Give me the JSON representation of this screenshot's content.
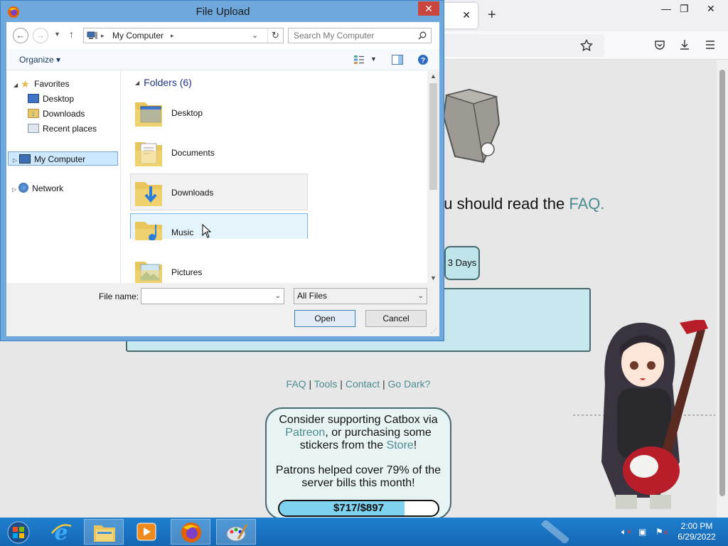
{
  "browser": {
    "tab_close": "✕",
    "new_tab": "+",
    "window_controls": {
      "minimize": "—",
      "restore": "❐",
      "close": "✕"
    },
    "nav_icons": [
      "star-icon",
      "pocket-icon",
      "download-icon",
      "menu-icon"
    ]
  },
  "page": {
    "faq_prefix": "ou should read the ",
    "faq_link": "FAQ.",
    "days_button": "3 Days",
    "footer_links": [
      "FAQ",
      "Tools",
      "Contact",
      "Go Dark?"
    ],
    "footer_sep": " | ",
    "support": {
      "line1_a": "Consider supporting Catbox via",
      "patreon": "Patreon",
      "line2_b": ", or purchasing some",
      "line3_a": "stickers from the ",
      "store": "Store",
      "line3_b": "!",
      "patrons": "Patrons helped cover 79% of the server bills this month!",
      "progress_label": "$717/$897",
      "progress_fraction": 0.79
    }
  },
  "dialog": {
    "title": "File Upload",
    "address": {
      "location": "My Computer",
      "separator": "▸"
    },
    "search_placeholder": "Search My Computer",
    "organize": "Organize ▾",
    "nav": {
      "favorites": "Favorites",
      "desktop": "Desktop",
      "downloads": "Downloads",
      "recent": "Recent places",
      "my_computer": "My Computer",
      "network": "Network"
    },
    "group_header": "Folders (6)",
    "folders": [
      "Desktop",
      "Documents",
      "Downloads",
      "Music",
      "Pictures"
    ],
    "file_name_label": "File name:",
    "file_name_value": "",
    "file_type": "All Files",
    "open_button": "Open",
    "cancel_button": "Cancel"
  },
  "taskbar": {
    "time": "2:00 PM",
    "date": "6/29/2022"
  },
  "colors": {
    "accent_link": "#4c8c90",
    "dialog_frame": "#6fa8dc",
    "taskbar": "#1568b3",
    "close_red": "#c9463d"
  }
}
